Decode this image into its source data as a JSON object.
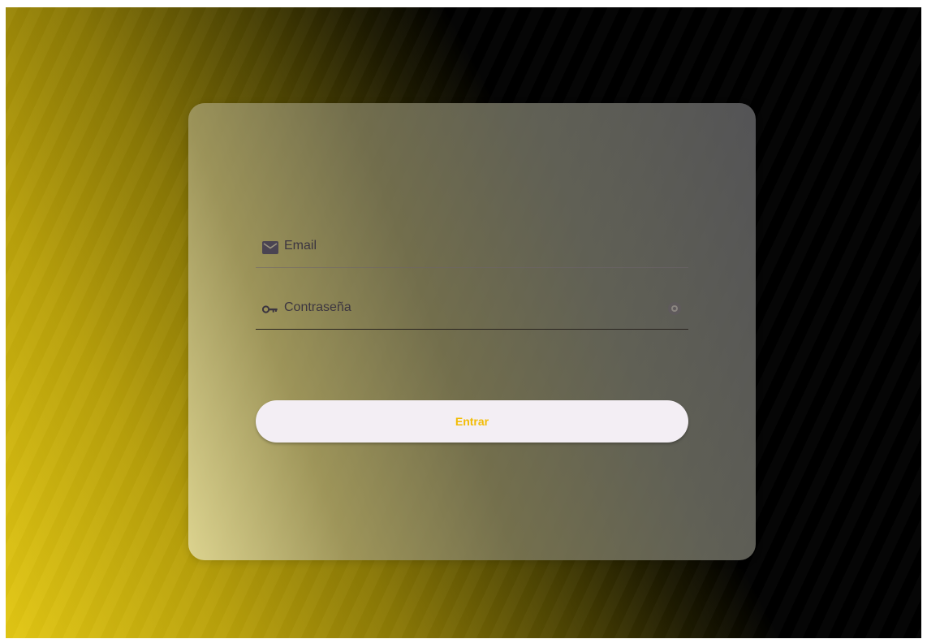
{
  "login": {
    "email_label": "Email",
    "password_label": "Contraseña",
    "submit_label": "Entrar"
  },
  "icons": {
    "email": "mail-icon",
    "password": "key-icon",
    "visibility": "eye-icon"
  },
  "colors": {
    "accent": "#f2bc05",
    "button_bg": "#f3eef4",
    "label": "#3c3640"
  }
}
